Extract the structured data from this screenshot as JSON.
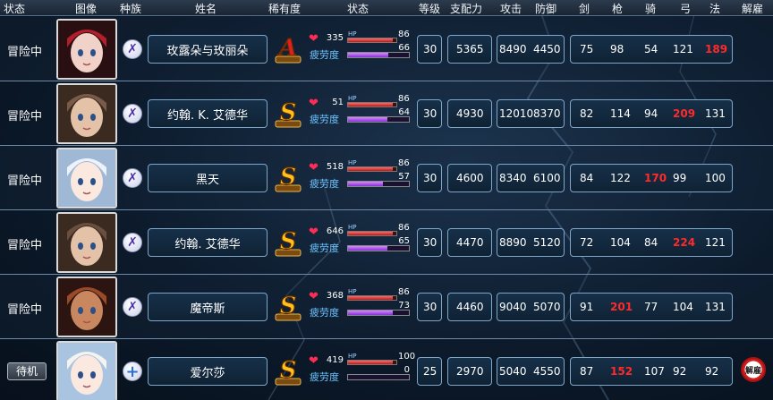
{
  "header": {
    "status": "状态",
    "image": "图像",
    "race": "种族",
    "name": "姓名",
    "rarity": "稀有度",
    "state": "状态",
    "level": "等级",
    "command": "支配力",
    "attack": "攻击",
    "defense": "防御",
    "sword": "剑",
    "spear": "枪",
    "cavalry": "骑",
    "bow": "弓",
    "magic": "法",
    "dismiss": "解雇"
  },
  "labels": {
    "hp": "HP",
    "fatigue": "疲劳度"
  },
  "rows": [
    {
      "status": "冒险中",
      "status_type": "text",
      "race_icon": "demon-icon",
      "name": "玫露朵与玫丽朵",
      "rarity": "A",
      "hp": "335",
      "hp_max": "86",
      "hp_fill": 0.93,
      "fatigue": "66",
      "fatigue_fill": 0.66,
      "level": "30",
      "command": "5365",
      "attack": "8490",
      "defense": "4450",
      "sword": "75",
      "spear": "98",
      "cavalry": "54",
      "bow": "121",
      "magic": "189",
      "highlight": "magic"
    },
    {
      "status": "冒险中",
      "status_type": "text",
      "race_icon": "demon-icon",
      "name": "约翰. K. 艾德华",
      "rarity": "S",
      "hp": "51",
      "hp_max": "86",
      "hp_fill": 0.93,
      "fatigue": "64",
      "fatigue_fill": 0.64,
      "level": "30",
      "command": "4930",
      "attack": "12010",
      "defense": "8370",
      "sword": "82",
      "spear": "114",
      "cavalry": "94",
      "bow": "209",
      "magic": "131",
      "highlight": "bow"
    },
    {
      "status": "冒险中",
      "status_type": "text",
      "race_icon": "demon-icon",
      "name": "黑天",
      "rarity": "S",
      "hp": "518",
      "hp_max": "86",
      "hp_fill": 0.93,
      "fatigue": "57",
      "fatigue_fill": 0.57,
      "level": "30",
      "command": "4600",
      "attack": "8340",
      "defense": "6100",
      "sword": "84",
      "spear": "122",
      "cavalry": "170",
      "bow": "99",
      "magic": "100",
      "highlight": "cavalry"
    },
    {
      "status": "冒险中",
      "status_type": "text",
      "race_icon": "demon-icon",
      "name": "约翰. 艾德华",
      "rarity": "S",
      "hp": "646",
      "hp_max": "86",
      "hp_fill": 0.93,
      "fatigue": "65",
      "fatigue_fill": 0.65,
      "level": "30",
      "command": "4470",
      "attack": "8890",
      "defense": "5120",
      "sword": "72",
      "spear": "104",
      "cavalry": "84",
      "bow": "224",
      "magic": "121",
      "highlight": "bow"
    },
    {
      "status": "冒险中",
      "status_type": "text",
      "race_icon": "demon-icon",
      "name": "魔帝斯",
      "rarity": "S",
      "hp": "368",
      "hp_max": "86",
      "hp_fill": 0.93,
      "fatigue": "73",
      "fatigue_fill": 0.73,
      "level": "30",
      "command": "4460",
      "attack": "9040",
      "defense": "5070",
      "sword": "91",
      "spear": "201",
      "cavalry": "77",
      "bow": "104",
      "magic": "131",
      "highlight": "spear"
    },
    {
      "status": "待机",
      "status_type": "button",
      "race_icon": "human-icon",
      "name": "爱尔莎",
      "rarity": "S",
      "hp": "419",
      "hp_max": "100",
      "hp_fill": 0.93,
      "fatigue": "0",
      "fatigue_fill": 0.0,
      "level": "25",
      "command": "2970",
      "attack": "5040",
      "defense": "4550",
      "sword": "87",
      "spear": "152",
      "cavalry": "107",
      "bow": "92",
      "magic": "92",
      "highlight": "spear",
      "dismiss": "解雇"
    }
  ]
}
